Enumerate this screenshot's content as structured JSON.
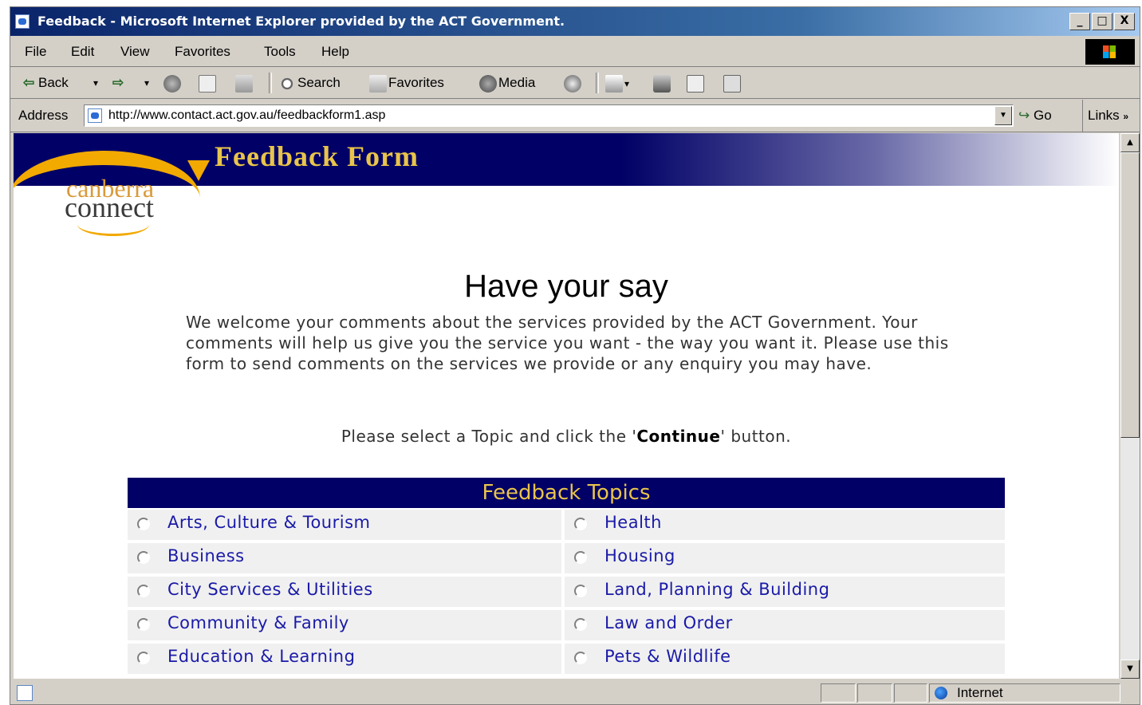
{
  "window": {
    "title": "Feedback - Microsoft Internet Explorer provided by the ACT Government.",
    "buttons": {
      "minimize": "_",
      "maximize": "□",
      "close": "X"
    }
  },
  "menu": {
    "items": [
      {
        "label": "File"
      },
      {
        "label": "Edit"
      },
      {
        "label": "View"
      },
      {
        "label": "Favorites"
      },
      {
        "label": "Tools"
      },
      {
        "label": "Help"
      }
    ]
  },
  "toolbar": {
    "back_label": "Back",
    "search_label": "Search",
    "favorites_label": "Favorites",
    "media_label": "Media"
  },
  "address": {
    "label": "Address",
    "url": "http://www.contact.act.gov.au/feedbackform1.asp",
    "go_label": "Go",
    "links_label": "Links"
  },
  "page": {
    "header_title": "Feedback Form",
    "logo_line1": "canberra",
    "logo_line2": "connect",
    "heading": "Have your say",
    "intro": "We welcome your comments about the services provided by the ACT Government. Your comments will help us give you the service you want - the way you want it. Please use this form to send comments on the services we provide or any enquiry you may have.",
    "instruction_before": "Please select a Topic and click the '",
    "instruction_bold": "Continue",
    "instruction_after": "' button.",
    "topics_heading": "Feedback Topics",
    "topics_left": [
      "Arts, Culture & Tourism",
      "Business",
      "City Services & Utilities",
      "Community & Family",
      "Education & Learning"
    ],
    "topics_right": [
      "Health",
      "Housing",
      "Land, Planning & Building",
      "Law and Order",
      "Pets & Wildlife"
    ]
  },
  "status": {
    "zone_label": "Internet"
  },
  "colors": {
    "header_navy": "#000066",
    "header_gold": "#e8c44a",
    "link_blue": "#1a1aa8",
    "logo_orange": "#f2a900"
  }
}
